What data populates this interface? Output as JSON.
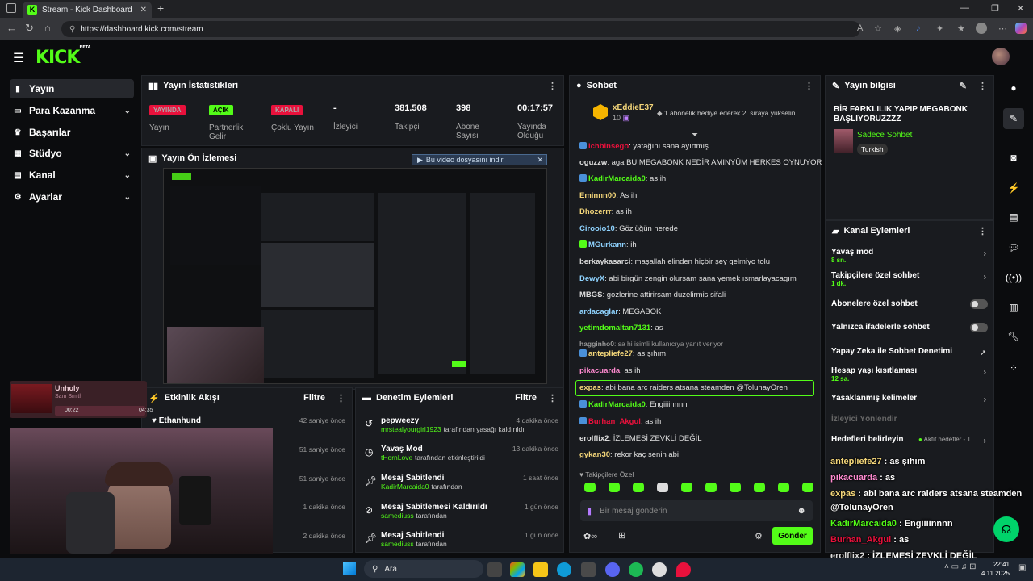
{
  "browser": {
    "tab_title": "Stream - Kick Dashboard",
    "url": "https://dashboard.kick.com/stream",
    "new_tab": "+"
  },
  "app": {
    "logo": "KICK",
    "logo_beta": "BETA",
    "sidebar": [
      {
        "label": "Yayın",
        "icon": "video-icon",
        "active": true
      },
      {
        "label": "Para Kazanma",
        "icon": "money-icon",
        "chev": true
      },
      {
        "label": "Başarılar",
        "icon": "trophy-icon"
      },
      {
        "label": "Stüdyo",
        "icon": "studio-icon",
        "chev": true
      },
      {
        "label": "Kanal",
        "icon": "channel-icon",
        "chev": true
      },
      {
        "label": "Ayarlar",
        "icon": "gear-icon",
        "chev": true
      }
    ]
  },
  "stats": {
    "title": "Yayın İstatistikleri",
    "items": [
      {
        "badge": "YAYINDA",
        "badge_color": "#e9113c",
        "label": "Yayın"
      },
      {
        "badge": "AÇIK",
        "badge_color": "#53fc18",
        "label": "Partnerlik Gelir"
      },
      {
        "badge": "KAPALI",
        "badge_color": "#e9113c",
        "label": "Çoklu Yayın"
      },
      {
        "value": "-",
        "label": "İzleyici"
      },
      {
        "value": "381.508",
        "label": "Takipçi"
      },
      {
        "value": "398",
        "label": "Abone Sayısı"
      },
      {
        "value": "00:17:57",
        "label": "Yayında Olduğu"
      }
    ]
  },
  "preview": {
    "title": "Yayın Ön İzlemesi",
    "download": "Bu video dosyasını indir"
  },
  "music": {
    "song": "Unholy",
    "artist": "Sam Smith",
    "elapsed": "00:22",
    "duration": "04:35"
  },
  "activity": {
    "title": "Etkinlik Akışı",
    "filter": "Filtre",
    "items": [
      {
        "name": "Ethanhund",
        "time": "42 saniye önce"
      },
      {
        "name": "",
        "time": "51 saniye önce"
      },
      {
        "name": "",
        "time": "51 saniye önce"
      },
      {
        "name": "",
        "time": "1 dakika önce"
      },
      {
        "name": "",
        "time": "2 dakika önce"
      }
    ]
  },
  "moderation": {
    "title": "Denetim Eylemleri",
    "filter": "Filtre",
    "items": [
      {
        "title": "pepweezy",
        "sub": "mrstealyourgirl1923",
        "sub2": "tarafından yasağı kaldırıldı",
        "time": "4 dakika önce",
        "icon": "undo-icon"
      },
      {
        "title": "Yavaş Mod",
        "sub": "tHornLove",
        "sub2": "tarafından etkinleştirildi",
        "time": "13 dakika önce",
        "icon": "clock-icon"
      },
      {
        "title": "Mesaj Sabitlendi",
        "sub": "KadirMarcaida0",
        "sub2": "tarafından",
        "time": "1 saat önce",
        "icon": "pin-icon"
      },
      {
        "title": "Mesaj Sabitlemesi Kaldırıldı",
        "sub": "samediuss",
        "sub2": "tarafından",
        "time": "1 gün önce",
        "icon": "unpin-icon"
      },
      {
        "title": "Mesaj Sabitlendi",
        "sub": "samediuss",
        "sub2": "tarafından",
        "time": "1 gün önce",
        "icon": "pin-icon"
      }
    ]
  },
  "chat": {
    "title": "Sohbet",
    "pinned_user": "xEddieE37",
    "pinned_count": "10",
    "pinned_text": "1 abonelik hediye ederek 2. sıraya yükselin",
    "messages": [
      {
        "name": "ichbinsego",
        "color": "#e9113c",
        "text": ": yatağını sana ayırtmış"
      },
      {
        "name": "oguzzw",
        "color": "#dddddd",
        "text": ": aga BU MEGABONK NEDİR AMINYÜM HERKES OYNUYOR"
      },
      {
        "name": "KadirMarcaida0",
        "color": "#53fc18",
        "text": ": as ih"
      },
      {
        "name": "Eminnn00",
        "color": "#f5d77a",
        "text": ": As ih"
      },
      {
        "name": "Dhozerrr",
        "color": "#f5d77a",
        "text": ": as ih"
      },
      {
        "name": "Cirooio10",
        "color": "#8fd3ff",
        "text": ": Gözlüğün nerede"
      },
      {
        "name": "MGurkann",
        "color": "#8fd3ff",
        "text": ": ih"
      },
      {
        "name": "berkaykasarci",
        "color": "#dddddd",
        "text": ": maşallah elinden hiçbir şey gelmiyo tolu"
      },
      {
        "name": "DewyX",
        "color": "#8fd3ff",
        "text": ": abi birgün zengin olursam sana yemek ısmarlayacagım"
      },
      {
        "name": "MBGS",
        "color": "#dddddd",
        "text": ": gozlerine attirirsam duzelirmis sifali"
      },
      {
        "name": "ardacaglar",
        "color": "#8fd3ff",
        "text": ": MEGABOK"
      },
      {
        "name": "yetimdomaltan7131",
        "color": "#53fc18",
        "text": ": as"
      },
      {
        "name": "hagginho0",
        "color": "#999999",
        "text": ": sa hi isimli kullanıcıya yanıt veriyor"
      },
      {
        "name": "antepliefe27",
        "color": "#f5d77a",
        "text": ": as şıhım"
      },
      {
        "name": "pikacuarda",
        "color": "#ff8ad0",
        "text": ": as ih"
      },
      {
        "name": "expas",
        "color": "#f5d77a",
        "text": ": abi bana arc raiders atsana steamden @TolunayOren"
      },
      {
        "name": "KadirMarcaida0",
        "color": "#53fc18",
        "text": ": Engiiiinnnn"
      },
      {
        "name": "Burhan_Akgul",
        "color": "#e9113c",
        "text": ": as ih"
      },
      {
        "name": "erolflix2",
        "color": "#dddddd",
        "text": ": İZLEMESİ ZEVKLİ DEĞİL"
      },
      {
        "name": "gykan30",
        "color": "#f5d77a",
        "text": ": rekor kaç senin abi"
      }
    ],
    "followers_label": "Takipçilere Özel",
    "input_placeholder": "Bir mesaj gönderin",
    "send": "Gönder"
  },
  "stream_info": {
    "title": "Yayın bilgisi",
    "stream_title": "BİR FARKLILIK YAPIP MEGABONK BAŞLIYORUZZZZ",
    "category": "Sadece Sohbet",
    "tag": "Turkish"
  },
  "channel_actions": {
    "title": "Kanal Eylemleri",
    "slow": "Yavaş mod",
    "slow_sub": "8 sn.",
    "followers": "Takipçilere özel sohbet",
    "followers_sub": "1 dk.",
    "subs": "Abonelere özel sohbet",
    "emotes": "Yalnızca ifadelerle sohbet",
    "ai": "Yapay Zeka ile Sohbet Denetimi",
    "age": "Hesap yaşı kısıtlaması",
    "age_sub": "12 sa.",
    "banned": "Yasaklanmış kelimeler",
    "redirect": "İzleyici Yönlendir",
    "goals": "Hedefleri belirleyin",
    "goals_sub": "Aktif hedefler - 1"
  },
  "overlay_chat": [
    {
      "name": "antepliefe27",
      "color": "#f5d77a",
      "text": " : as şıhım"
    },
    {
      "name": "pikacuarda",
      "color": "#ff8ad0",
      "text": " : as "
    },
    {
      "name": "expas",
      "color": "#f5d77a",
      "text": " : abi bana arc raiders atsana steamden"
    },
    {
      "name": "",
      "color": "#ffffff",
      "text": "@TolunayOren"
    },
    {
      "name": "KadirMarcaida0",
      "color": "#53fc18",
      "text": " : Engiiiinnnn"
    },
    {
      "name": "Burhan_Akgul",
      "color": "#e9113c",
      "text": " : as "
    },
    {
      "name": "erolflix2",
      "color": "#dddddd",
      "text": " : İZLEMESİ ZEVKLİ DEĞİL"
    },
    {
      "name": "gykan30",
      "color": "#f5d77a",
      "text": " : rekor kaç senin abi"
    }
  ],
  "taskbar": {
    "search": "Ara",
    "time": "22:41",
    "date": "4.11.2025"
  }
}
